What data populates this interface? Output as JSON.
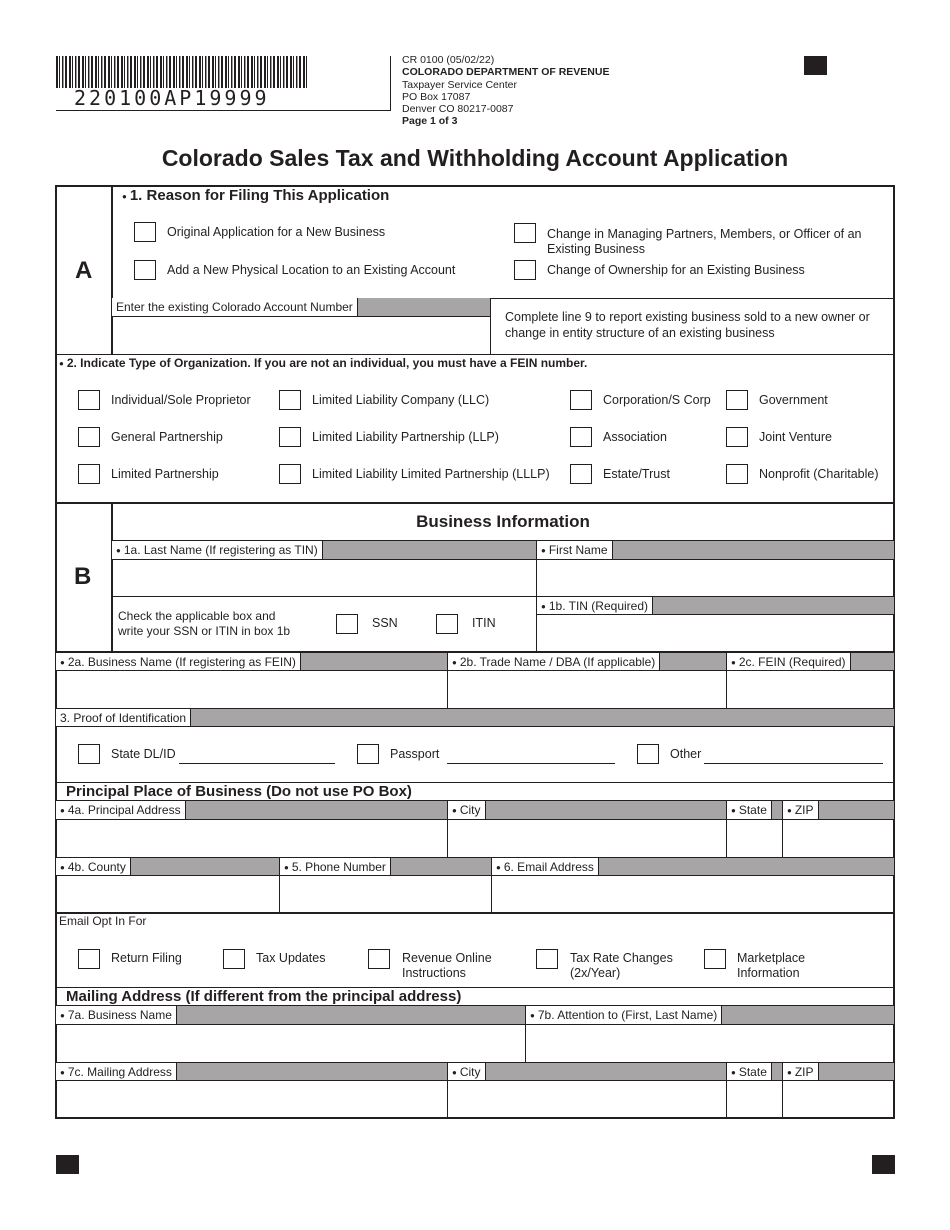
{
  "header": {
    "barcode_number": "220100AP19999",
    "form_id": "CR 0100 (05/02/22)",
    "department": "COLORADO DEPARTMENT OF REVENUE",
    "address_lines": [
      "Taxpayer Service Center",
      "PO Box 17087",
      "Denver CO 80217-0087"
    ],
    "page": "Page 1 of 3"
  },
  "title": "Colorado Sales Tax and Withholding Account Application",
  "section_a": {
    "letter": "A",
    "reason": {
      "heading": "1. Reason for Filing This Application",
      "options": [
        "Original Application for a New Business",
        "Add a New Physical Location to an Existing Account",
        "Change in Managing Partners, Members, or Officer of an Existing Business",
        "Change of Ownership for an Existing Business"
      ],
      "option_line1": "Change in Managing Partners, Members, or Officer of an",
      "option_line2": "Existing Business",
      "account_label": "Enter the existing Colorado Account Number",
      "note_line1": "Complete line 9 to report existing business sold to a new owner or",
      "note_line2": "change in entity structure of an existing business"
    },
    "org_type": {
      "heading": "2. Indicate Type of Organization. If you are not an individual, you must have a FEIN number.",
      "options": [
        "Individual/Sole Proprietor",
        "Limited Liability Company (LLC)",
        "Corporation/S Corp",
        "Government",
        "General Partnership",
        "Limited Liability Partnership (LLP)",
        "Association",
        "Joint Venture",
        "Limited Partnership",
        "Limited Liability Limited Partnership (LLLP)",
        "Estate/Trust",
        "Nonprofit (Charitable)"
      ]
    }
  },
  "section_b": {
    "letter": "B",
    "heading": "Business Information",
    "last_name_label": "1a. Last Name (If registering as TIN)",
    "first_name_label": "First Name",
    "check_note_line1": "Check the applicable box and",
    "check_note_line2": "write your SSN or ITIN in box 1b",
    "ssn_label": "SSN",
    "itin_label": "ITIN",
    "tin_label": "1b. TIN (Required)",
    "business_name_label": "2a. Business Name (If registering as FEIN)",
    "trade_name_label": "2b. Trade Name / DBA (If applicable)",
    "fein_label": "2c. FEIN (Required)",
    "proof_label": "3. Proof of Identification",
    "proof_options": [
      "State DL/ID",
      "Passport",
      "Other"
    ],
    "principal": {
      "heading": "Principal Place of Business (Do not use PO Box)",
      "address_label": "4a. Principal Address",
      "city_label": "City",
      "state_label": "State",
      "zip_label": "ZIP",
      "county_label": "4b. County",
      "phone_label": "5. Phone Number",
      "email_label": "6. Email Address"
    },
    "email_opt": {
      "label": "Email Opt In For",
      "options": [
        "Return Filing",
        "Tax Updates",
        "Revenue Online",
        "Tax Rate Changes",
        "Marketplace"
      ],
      "options_line2": [
        "",
        "",
        "Instructions",
        "(2x/Year)",
        "Information"
      ]
    },
    "mailing": {
      "heading": "Mailing Address (If different from the principal address)",
      "business_name_label": "7a. Business Name",
      "attention_label": "7b. Attention to (First, Last Name)",
      "address_label": "7c. Mailing Address",
      "city_label": "City",
      "state_label": "State",
      "zip_label": "ZIP"
    }
  }
}
